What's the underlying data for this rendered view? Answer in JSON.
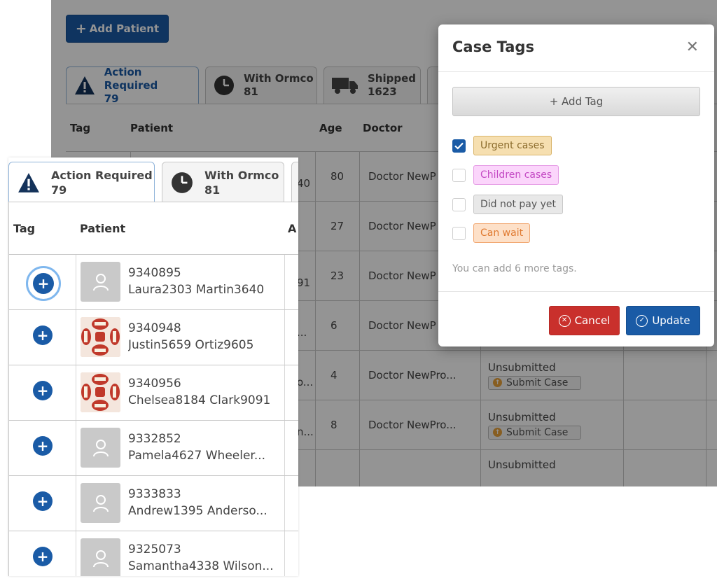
{
  "toolbar": {
    "add_patient_label": "Add Patient",
    "add_patient_icon": "plus-icon"
  },
  "tabs": [
    {
      "label": "Action Required",
      "count": "79",
      "icon": "warning-icon"
    },
    {
      "label": "With Ormco",
      "count": "81",
      "icon": "clock-icon"
    },
    {
      "label": "Shipped",
      "count": "1623",
      "icon": "truck-icon"
    }
  ],
  "table": {
    "headers": {
      "tag": "Tag",
      "patient": "Patient",
      "age": "Age",
      "doctor": "Doctor"
    },
    "rows": [
      {
        "id_fragment": "40",
        "age": "80",
        "doctor": "Doctor NewP",
        "status": "",
        "action": ""
      },
      {
        "id_fragment": "",
        "age": "27",
        "doctor": "Doctor NewP",
        "status": "",
        "action": ""
      },
      {
        "id_fragment": "91",
        "age": "23",
        "doctor": "Doctor NewP",
        "status": "",
        "action": ""
      },
      {
        "id_fragment": "...",
        "age": "6",
        "doctor": "Doctor NewP",
        "status": "",
        "action": ""
      },
      {
        "id_fragment": "o...",
        "age": "4",
        "doctor": "Doctor NewPro...",
        "status": "Unsubmitted",
        "action": "Submit Case"
      },
      {
        "id_fragment": "n...",
        "age": "8",
        "doctor": "Doctor NewPro...",
        "status": "Unsubmitted",
        "action": "Submit Case"
      },
      {
        "id_fragment": "",
        "age": "",
        "doctor": "",
        "status": "Unsubmitted",
        "action": ""
      }
    ]
  },
  "inset": {
    "header_age_fragment": "A",
    "patients": [
      {
        "id": "9340895",
        "name": "Laura2303 Martin3640",
        "avatar": "placeholder",
        "focused": true
      },
      {
        "id": "9340948",
        "name": "Justin5659 Ortiz9605",
        "avatar": "photo",
        "focused": false
      },
      {
        "id": "9340956",
        "name": "Chelsea8184 Clark9091",
        "avatar": "photo",
        "focused": false
      },
      {
        "id": "9332852",
        "name": "Pamela4627 Wheeler...",
        "avatar": "placeholder",
        "focused": false
      },
      {
        "id": "9333833",
        "name": "Andrew1395 Anderso...",
        "avatar": "placeholder",
        "focused": false
      },
      {
        "id": "9325073",
        "name": "Samantha4338 Wilson...",
        "avatar": "placeholder",
        "focused": false
      }
    ]
  },
  "modal": {
    "title": "Case Tags",
    "add_tag_label": "+ Add Tag",
    "tags": [
      {
        "label": "Urgent cases",
        "checked": true,
        "bg": "#f6dfb0",
        "border": "#d9b46a",
        "color": "#8a6a2a"
      },
      {
        "label": "Children cases",
        "checked": false,
        "bg": "#fbd5fb",
        "border": "#e59be5",
        "color": "#c44ac4"
      },
      {
        "label": "Did not pay yet",
        "checked": false,
        "bg": "#e8e8e8",
        "border": "#c8c8c8",
        "color": "#555555"
      },
      {
        "label": "Can wait",
        "checked": false,
        "bg": "#fde0c8",
        "border": "#f1a66f",
        "color": "#e07a30"
      }
    ],
    "hint": "You can add 6 more tags.",
    "cancel_label": "Cancel",
    "update_label": "Update"
  },
  "colors": {
    "primary": "#1a5ba6",
    "danger": "#c9302c",
    "warning": "#e9a23b"
  }
}
